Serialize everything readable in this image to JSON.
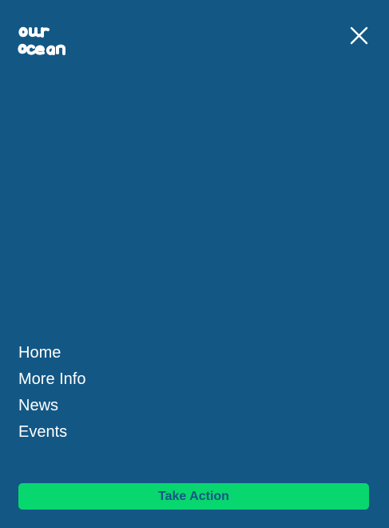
{
  "brand": {
    "logo_text": [
      "our",
      "ocean"
    ],
    "logo_icon": "brush-lettering-logo",
    "accent_color": "#08d76f",
    "background_color": "#135785"
  },
  "header": {
    "close_icon": "close-icon"
  },
  "nav": {
    "items": [
      {
        "label": "Home"
      },
      {
        "label": "More Info"
      },
      {
        "label": "News"
      },
      {
        "label": "Events"
      }
    ]
  },
  "cta": {
    "label": "Take Action"
  }
}
